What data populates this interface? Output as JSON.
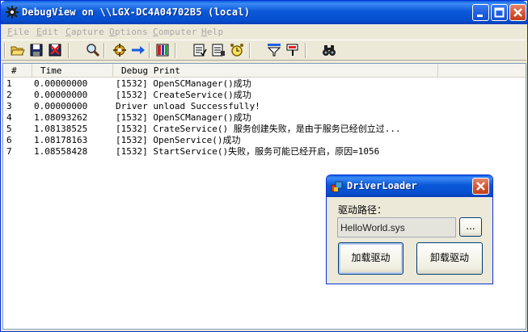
{
  "window": {
    "title": "DebugView on \\\\LGX-DC4A04702B5 (local)",
    "icon": "gear-bug-icon"
  },
  "menu": [
    {
      "key": "F",
      "rest": "ile"
    },
    {
      "key": "E",
      "rest": "dit"
    },
    {
      "key": "C",
      "rest": "apture"
    },
    {
      "key": "O",
      "rest": "ptions"
    },
    {
      "key": "C",
      "rest": "omputer"
    },
    {
      "key": "H",
      "rest": "elp"
    }
  ],
  "toolbar": {
    "icons": [
      "open-icon",
      "save-icon",
      "delete-icon",
      "find-icon",
      "capture-icon",
      "autoscroll-icon",
      "capture-win32-icon",
      "history-icon",
      "clock-time-icon",
      "filter-icon",
      "highlight-icon",
      "find-next-icon"
    ]
  },
  "listview": {
    "columns": {
      "num": "#",
      "time": "Time",
      "print": "Debug Print"
    },
    "rows": [
      {
        "num": "1",
        "time": "0.00000000",
        "print": "[1532] OpenSCManager()成功"
      },
      {
        "num": "2",
        "time": "0.00000000",
        "print": "[1532] CreateService()成功"
      },
      {
        "num": "3",
        "time": "0.00000000",
        "print": "Driver unload Successfully!"
      },
      {
        "num": "4",
        "time": "1.08093262",
        "print": "[1532] OpenSCManager()成功"
      },
      {
        "num": "5",
        "time": "1.08138525",
        "print": "[1532] CrateService() 服务创建失败，是由于服务已经创立过..."
      },
      {
        "num": "6",
        "time": "1.08178163",
        "print": "[1532] OpenService()成功"
      },
      {
        "num": "7",
        "time": "1.08558428",
        "print": "[1532] StartService()失败，服务可能已经开启，原因=1056"
      }
    ]
  },
  "dialog": {
    "title": "DriverLoader",
    "path_label": "驱动路径：",
    "path_value": "HelloWorld.sys",
    "browse_label": "...",
    "load_label": "加载驱动",
    "unload_label": "卸载驱动"
  },
  "colors": {
    "title_bar": "#0a58d8",
    "close_button": "#d4502e",
    "window_bg": "#ece9d8",
    "menu_disabled": "#a7a7a7"
  }
}
